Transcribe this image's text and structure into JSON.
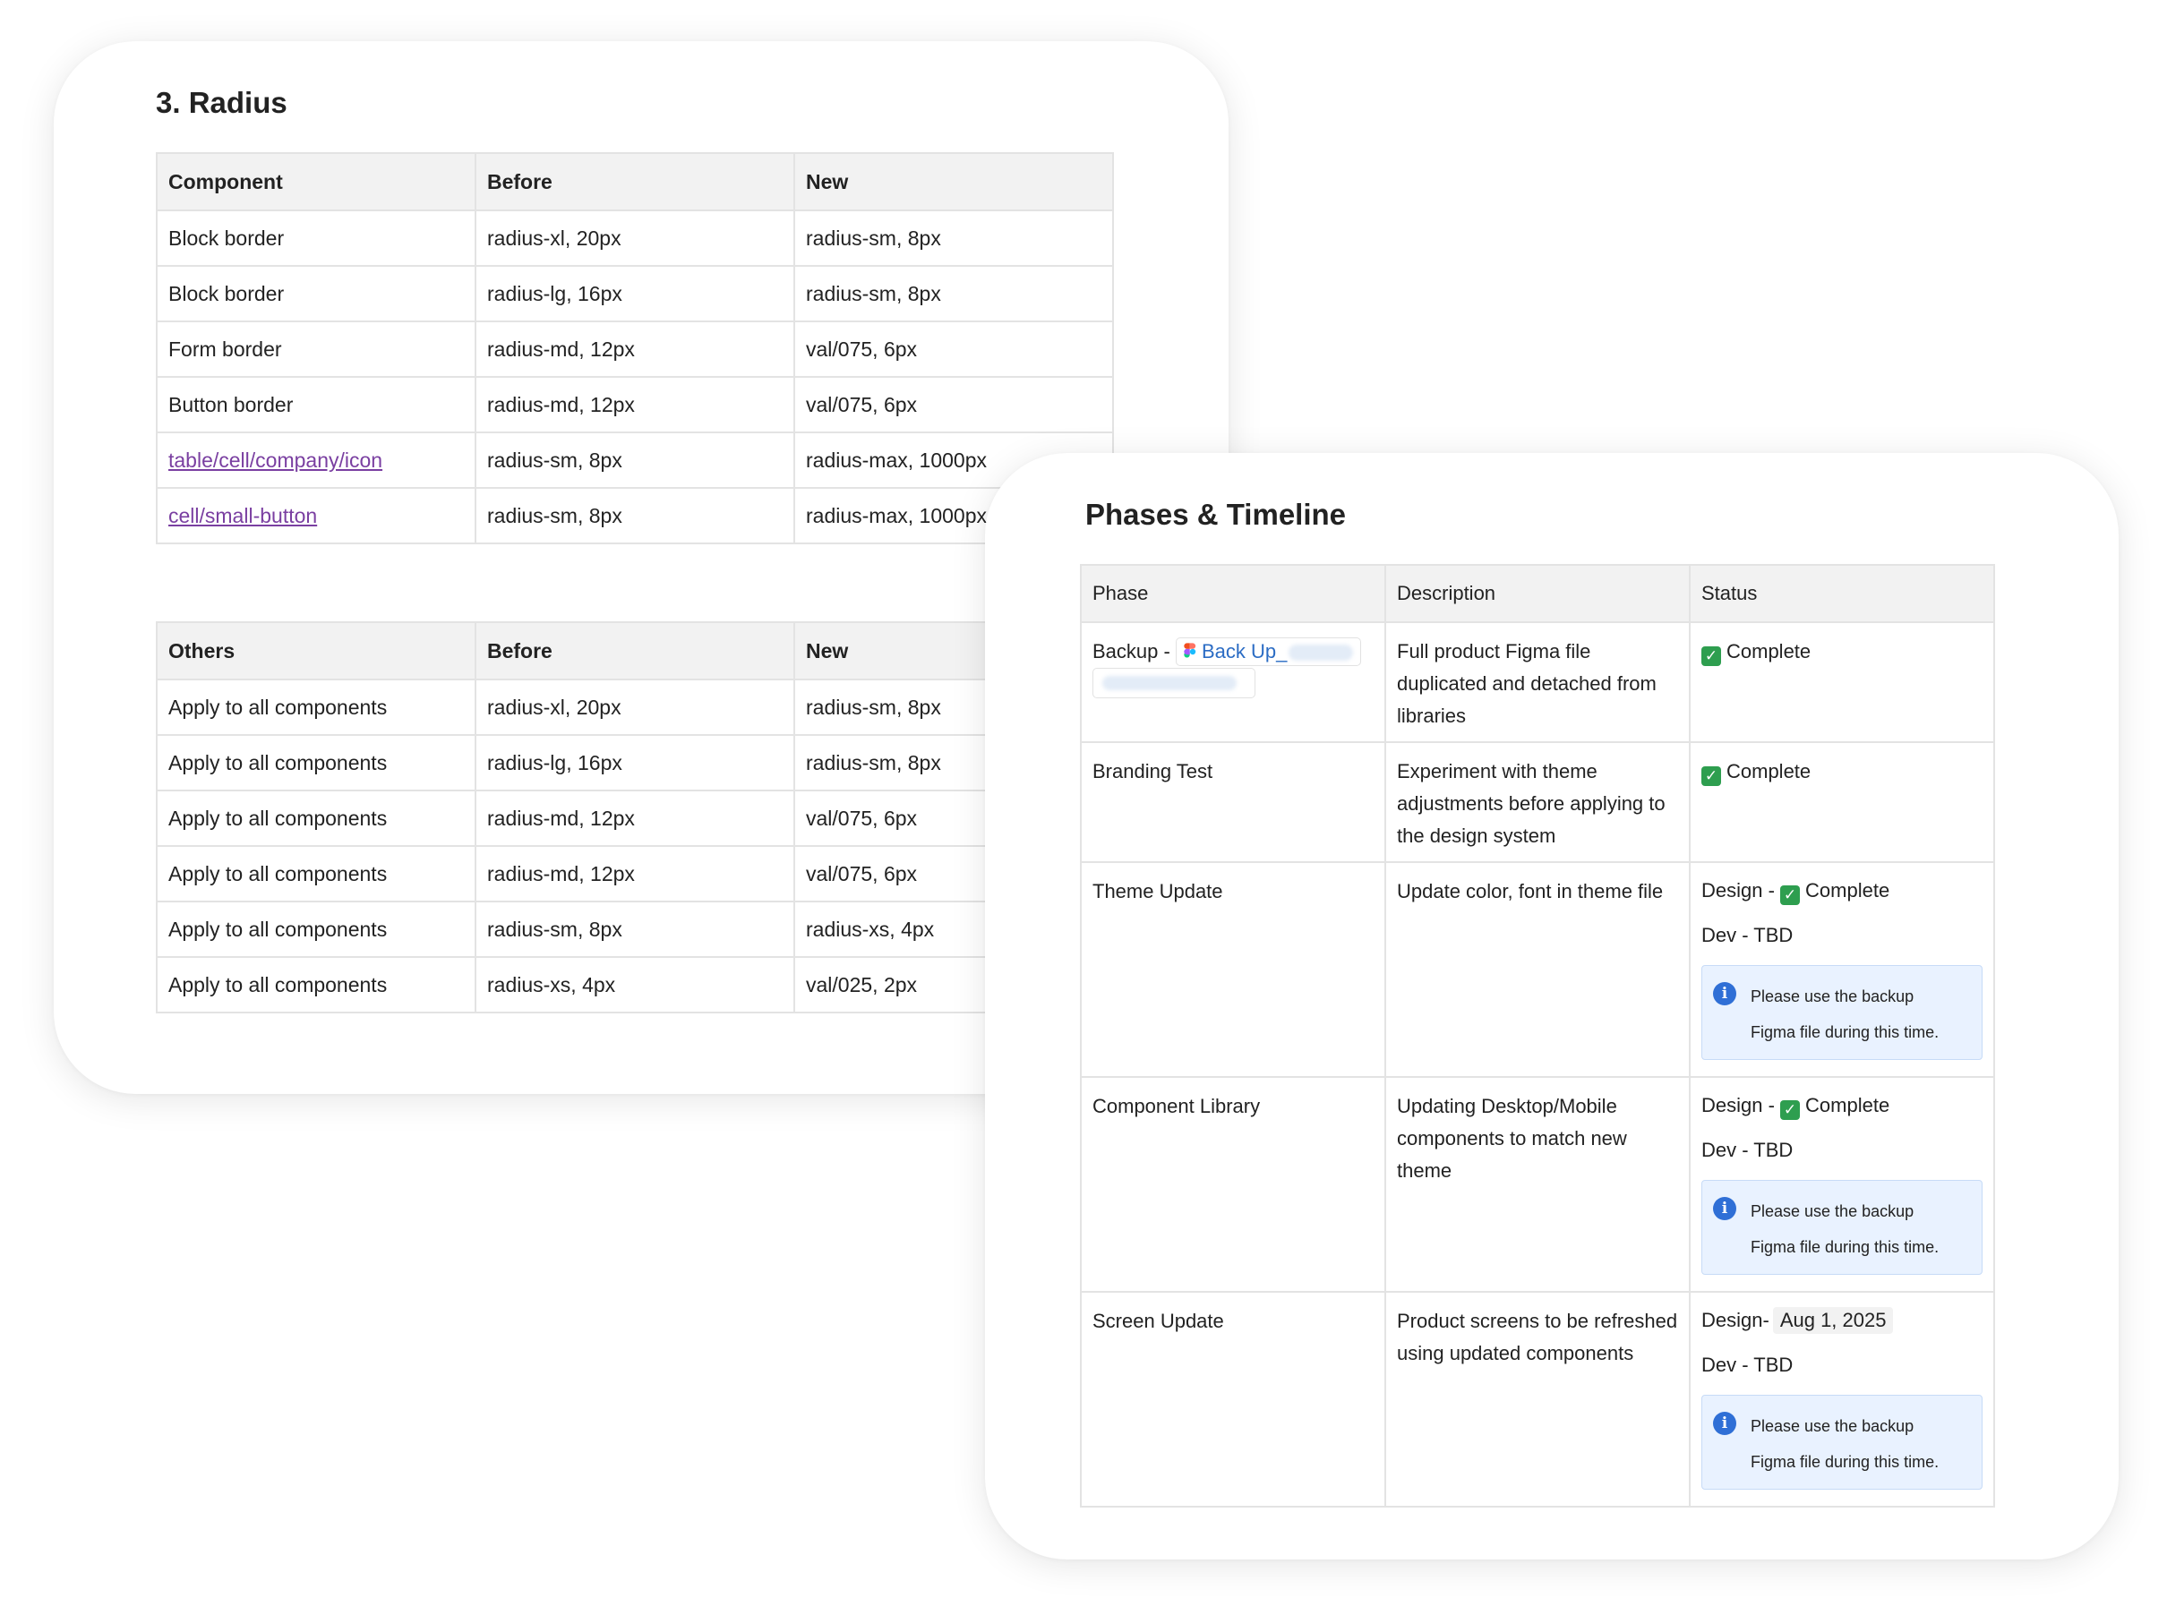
{
  "radius_card": {
    "title": "3. Radius",
    "table1": {
      "headers": [
        "Component",
        "Before",
        "New"
      ],
      "rows": [
        {
          "component": "Block border",
          "before": "radius-xl, 20px",
          "new": "radius-sm, 8px"
        },
        {
          "component": "Block border",
          "before": "radius-lg, 16px",
          "new": "radius-sm, 8px"
        },
        {
          "component": "Form border",
          "before": "radius-md, 12px",
          "new": "val/075, 6px"
        },
        {
          "component": "Button border",
          "before": "radius-md, 12px",
          "new": "val/075, 6px"
        },
        {
          "component": "table/cell/company/icon",
          "before": "radius-sm, 8px",
          "new": "radius-max, 1000px"
        },
        {
          "component": "cell/small-button",
          "before": "radius-sm, 8px",
          "new": "radius-max, 1000px"
        }
      ]
    },
    "table2": {
      "headers": [
        "Others",
        "Before",
        "New"
      ],
      "rows": [
        {
          "component": "Apply to all components",
          "before": "radius-xl, 20px",
          "new": "radius-sm, 8px"
        },
        {
          "component": "Apply to all components",
          "before": "radius-lg, 16px",
          "new": "radius-sm, 8px"
        },
        {
          "component": "Apply to all components",
          "before": "radius-md, 12px",
          "new": "val/075, 6px"
        },
        {
          "component": "Apply to all components",
          "before": "radius-md, 12px",
          "new": "val/075, 6px"
        },
        {
          "component": "Apply to all components",
          "before": "radius-sm, 8px",
          "new": "radius-xs, 4px"
        },
        {
          "component": "Apply to all components",
          "before": "radius-xs, 4px",
          "new": "val/025, 2px"
        }
      ]
    }
  },
  "phases_card": {
    "title": "Phases & Timeline",
    "headers": [
      "Phase",
      "Description",
      "Status"
    ],
    "rows": [
      {
        "phase": "Backup -",
        "phase_link": "Back Up_",
        "description": "Full product Figma file duplicated and detached from libraries",
        "status": "Complete"
      },
      {
        "phase": "Branding Test",
        "description": "Experiment with theme adjustments before applying to the design system",
        "status": "Complete"
      },
      {
        "phase": "Theme Update",
        "description": "Update color, font in theme file",
        "design_prefix": "Design -",
        "design_status": "Complete",
        "dev_status": "Dev - TBD",
        "info_line1": "Please use the backup",
        "info_line2": "Figma file during this time."
      },
      {
        "phase": "Component Library",
        "description": "Updating Desktop/Mobile components to match new theme",
        "design_prefix": "Design -",
        "design_status": "Complete",
        "dev_status": "Dev - TBD",
        "info_line1": "Please use the backup",
        "info_line2": "Figma file during this time."
      },
      {
        "phase": "Screen Update",
        "description": "Product screens to be refreshed using updated components",
        "design_prefix": "Design-",
        "design_date": "Aug 1, 2025",
        "dev_status": "Dev - TBD",
        "info_line1": "Please use the backup",
        "info_line2": "Figma file during this time."
      }
    ]
  },
  "colors": {
    "link_purple": "#7a3fa1",
    "link_blue": "#2b6cc4",
    "check_green": "#2e9e4f",
    "info_bg": "#e9f2ff",
    "info_icon": "#2f6fd6",
    "header_bg": "#f2f2f2"
  },
  "icons": {
    "check": "check-box-icon",
    "info": "info-icon",
    "figma": "figma-icon"
  }
}
